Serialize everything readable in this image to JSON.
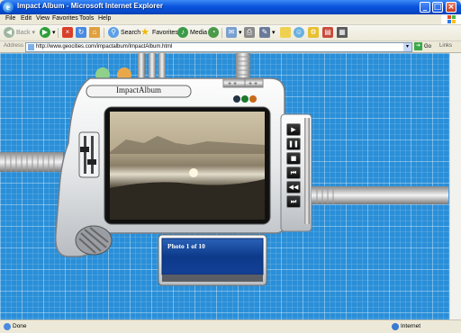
{
  "window": {
    "title": "Impact Album - Microsoft Internet Explorer"
  },
  "menu": [
    "File",
    "Edit",
    "View",
    "Favorites",
    "Tools",
    "Help"
  ],
  "toolbar": {
    "back": "Back",
    "search": "Search",
    "favorites": "Favorites",
    "media": "Media"
  },
  "address": {
    "label": "Address",
    "url": "http://www.geocities.com/impactalbum/ImpactAlbum.html",
    "go": "Go",
    "links": "Links"
  },
  "app": {
    "title": "ImpactAlbum",
    "caption": "Photo 1 of 10",
    "controls": [
      {
        "icon": "next-icon",
        "glyph": "▶"
      },
      {
        "icon": "pause-icon",
        "glyph": "❚❚"
      },
      {
        "icon": "stop-icon",
        "glyph": "■"
      },
      {
        "icon": "first-icon",
        "glyph": "⏮"
      },
      {
        "icon": "rewind-icon",
        "glyph": "◀◀"
      },
      {
        "icon": "last-icon",
        "glyph": "⏭"
      }
    ]
  },
  "status": {
    "left": "Done",
    "zone": "Internet"
  }
}
